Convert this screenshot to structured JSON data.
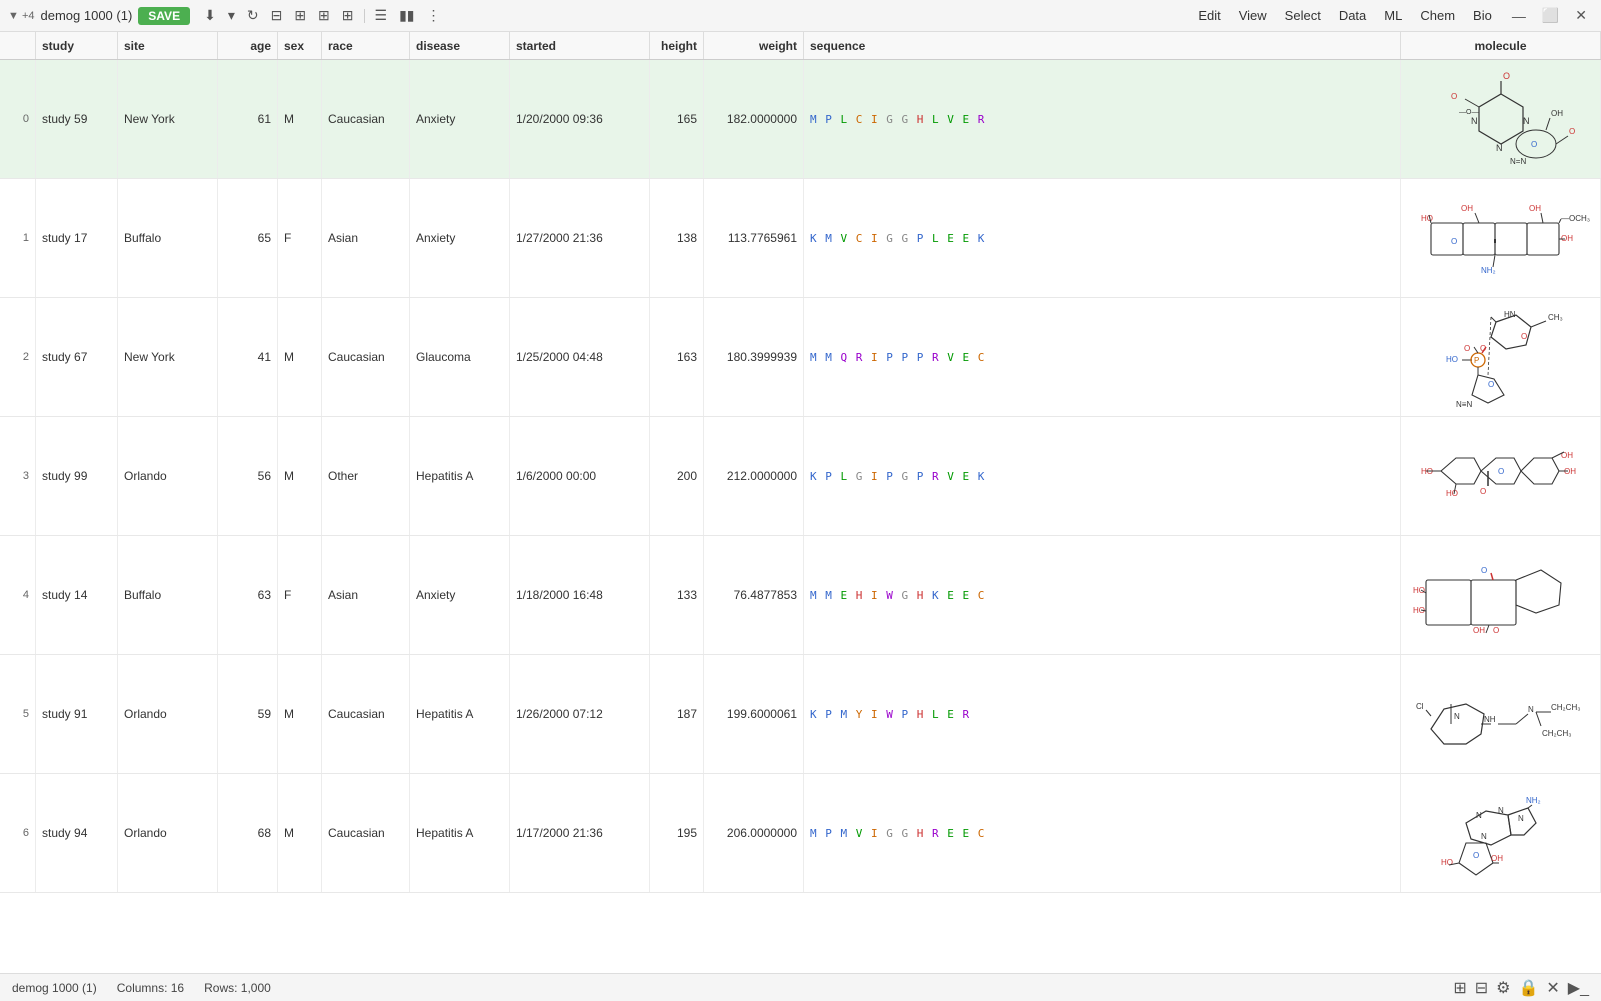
{
  "titlebar": {
    "pin": "▼ +4",
    "title": "demog 1000 (1)",
    "save_label": "SAVE",
    "menus": [
      "Edit",
      "View",
      "Select",
      "Data",
      "ML",
      "Chem",
      "Bio"
    ]
  },
  "toolbar": {
    "icons": [
      "download",
      "refresh",
      "filter",
      "grid1",
      "grid2",
      "grid3",
      "list",
      "bar",
      "scatter"
    ]
  },
  "columns": [
    {
      "key": "idx",
      "label": "",
      "class": "cell-idx"
    },
    {
      "key": "study",
      "label": "study",
      "class": "cell-study"
    },
    {
      "key": "site",
      "label": "site",
      "class": "cell-site"
    },
    {
      "key": "age",
      "label": "age",
      "class": "cell-age"
    },
    {
      "key": "sex",
      "label": "sex",
      "class": "cell-sex"
    },
    {
      "key": "race",
      "label": "race",
      "class": "cell-race"
    },
    {
      "key": "disease",
      "label": "disease",
      "class": "cell-disease"
    },
    {
      "key": "started",
      "label": "started",
      "class": "cell-started"
    },
    {
      "key": "height",
      "label": "height",
      "class": "cell-height"
    },
    {
      "key": "weight",
      "label": "weight",
      "class": "cell-weight"
    },
    {
      "key": "sequence",
      "label": "sequence",
      "class": "cell-sequence"
    },
    {
      "key": "molecule",
      "label": "molecule",
      "class": "cell-molecule"
    }
  ],
  "rows": [
    {
      "idx": "0",
      "study": "study 59",
      "site": "New York",
      "age": "61",
      "sex": "M",
      "race": "Caucasian",
      "disease": "Anxiety",
      "started": "1/20/2000 09:36",
      "height": "165",
      "weight": "182.0000000",
      "sequence": "M P L C I G G H L V E R",
      "seq_data": [
        "M",
        "P",
        "L",
        "C",
        "I",
        "G",
        "G",
        "H",
        "L",
        "V",
        "E",
        "R"
      ],
      "selected": true,
      "molecule_id": 0
    },
    {
      "idx": "1",
      "study": "study 17",
      "site": "Buffalo",
      "age": "65",
      "sex": "F",
      "race": "Asian",
      "disease": "Anxiety",
      "started": "1/27/2000 21:36",
      "height": "138",
      "weight": "113.7765961",
      "sequence": "K M V C I G G P L E E K",
      "seq_data": [
        "K",
        "M",
        "V",
        "C",
        "I",
        "G",
        "G",
        "P",
        "L",
        "E",
        "E",
        "K"
      ],
      "selected": false,
      "molecule_id": 1
    },
    {
      "idx": "2",
      "study": "study 67",
      "site": "New York",
      "age": "41",
      "sex": "M",
      "race": "Caucasian",
      "disease": "Glaucoma",
      "started": "1/25/2000 04:48",
      "height": "163",
      "weight": "180.3999939",
      "sequence": "M M Q R I P P P R V E C",
      "seq_data": [
        "M",
        "M",
        "Q",
        "R",
        "I",
        "P",
        "P",
        "P",
        "R",
        "V",
        "E",
        "C"
      ],
      "selected": false,
      "molecule_id": 2
    },
    {
      "idx": "3",
      "study": "study 99",
      "site": "Orlando",
      "age": "56",
      "sex": "M",
      "race": "Other",
      "disease": "Hepatitis A",
      "started": "1/6/2000 00:00",
      "height": "200",
      "weight": "212.0000000",
      "sequence": "K P L G I P G P R V E K",
      "seq_data": [
        "K",
        "P",
        "L",
        "G",
        "I",
        "P",
        "G",
        "P",
        "R",
        "V",
        "E",
        "K"
      ],
      "selected": false,
      "molecule_id": 3
    },
    {
      "idx": "4",
      "study": "study 14",
      "site": "Buffalo",
      "age": "63",
      "sex": "F",
      "race": "Asian",
      "disease": "Anxiety",
      "started": "1/18/2000 16:48",
      "height": "133",
      "weight": "76.4877853",
      "sequence": "M M E H I W G H K E E C",
      "seq_data": [
        "M",
        "M",
        "E",
        "H",
        "I",
        "W",
        "G",
        "H",
        "K",
        "E",
        "E",
        "C"
      ],
      "selected": false,
      "molecule_id": 4
    },
    {
      "idx": "5",
      "study": "study 91",
      "site": "Orlando",
      "age": "59",
      "sex": "M",
      "race": "Caucasian",
      "disease": "Hepatitis A",
      "started": "1/26/2000 07:12",
      "height": "187",
      "weight": "199.6000061",
      "sequence": "K P M Y I W P H L E R",
      "seq_data": [
        "K",
        "P",
        "M",
        "Y",
        "I",
        "W",
        "P",
        "H",
        "L",
        "E",
        "R"
      ],
      "selected": false,
      "molecule_id": 5
    },
    {
      "idx": "6",
      "study": "study 94",
      "site": "Orlando",
      "age": "68",
      "sex": "M",
      "race": "Caucasian",
      "disease": "Hepatitis A",
      "started": "1/17/2000 21:36",
      "height": "195",
      "weight": "206.0000000",
      "sequence": "M P M V I G G H R E E C",
      "seq_data": [
        "M",
        "P",
        "M",
        "V",
        "I",
        "G",
        "G",
        "H",
        "R",
        "E",
        "E",
        "C"
      ],
      "selected": false,
      "molecule_id": 6
    }
  ],
  "statusbar": {
    "dataset": "demog 1000 (1)",
    "columns": "Columns: 16",
    "rows": "Rows: 1,000"
  }
}
